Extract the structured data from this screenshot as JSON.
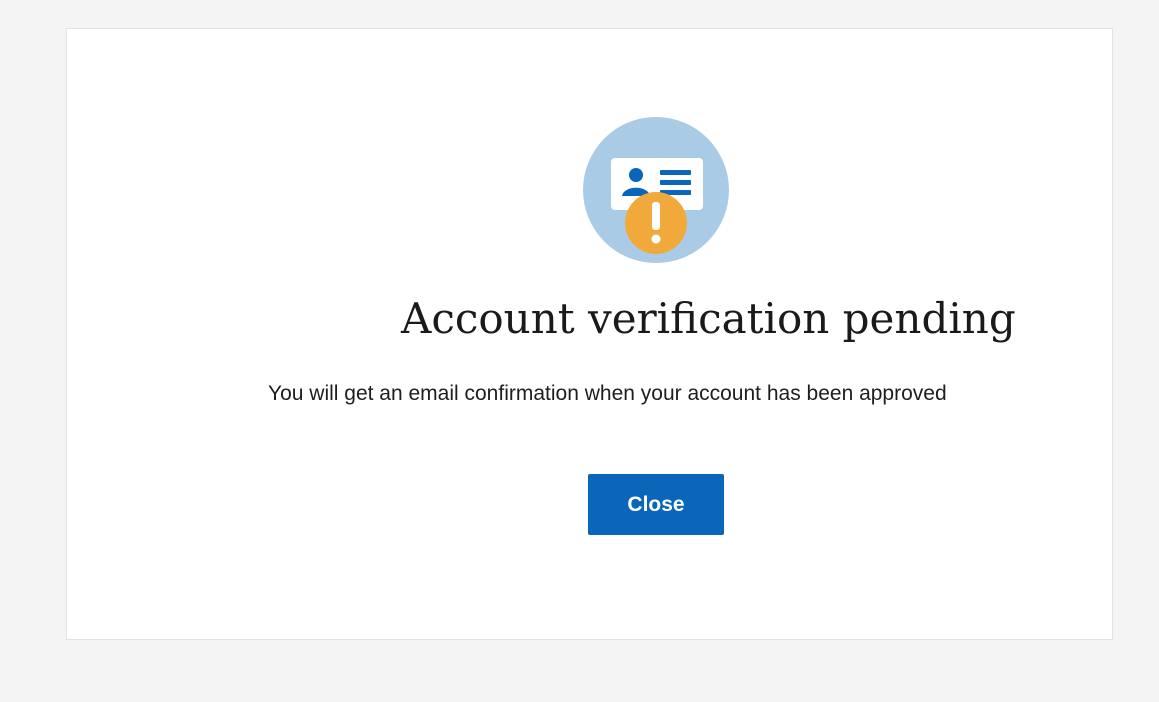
{
  "dialog": {
    "icon": "id-card-warning-icon",
    "title": "Account  verification pending",
    "message": "You will get an email confirmation when your account has been approved",
    "close_label": "Close"
  },
  "colors": {
    "page_background": "#f4f4f4",
    "dialog_background": "#ffffff",
    "icon_circle": "#a9cbe6",
    "icon_blue": "#0a66b9",
    "warning_orange": "#f2a93b",
    "button_background": "#0a66b9",
    "button_text": "#ffffff"
  }
}
